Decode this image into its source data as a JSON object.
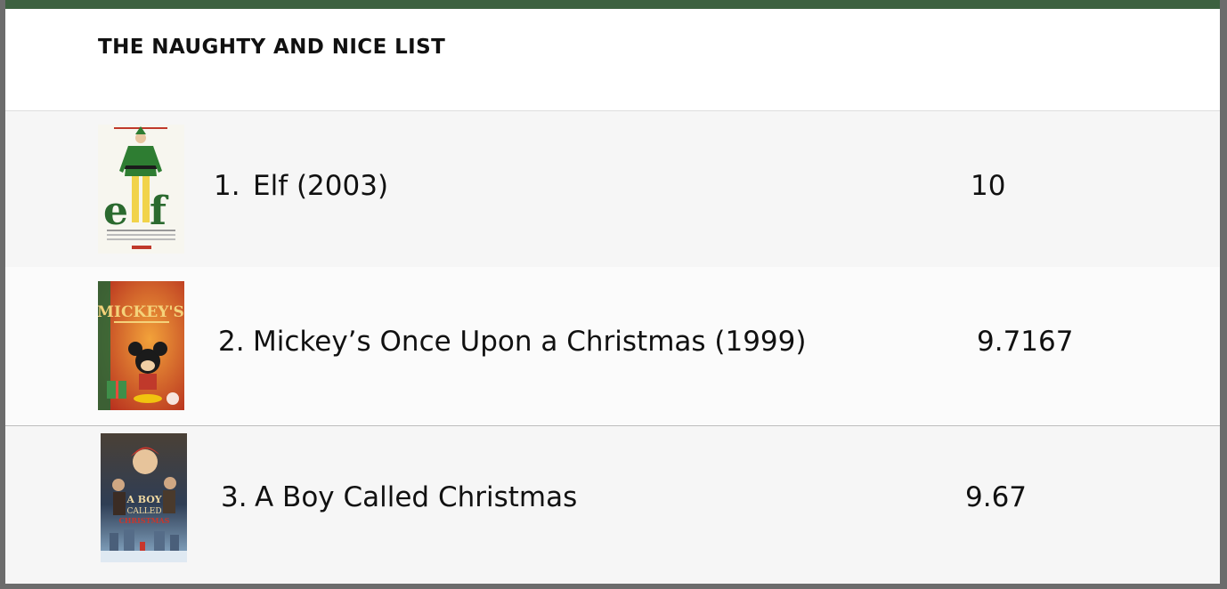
{
  "list": {
    "title": "THE NAUGHTY AND NICE LIST",
    "entries": [
      {
        "rank": "1.",
        "title": "Elf (2003)",
        "score": "10",
        "poster": {
          "icon": "elf-poster-image",
          "background": "#f7f6ef",
          "accent": "#2e7d32",
          "text_color": "#2b6a2f"
        }
      },
      {
        "rank": "2.",
        "title": "Mickey’s Once Upon a Christmas (1999)",
        "score": "9.7167",
        "poster": {
          "icon": "mickey-christmas-poster-image",
          "background": "#d9552b",
          "accent": "#1d6b3a",
          "text_color": "#f4d27a"
        }
      },
      {
        "rank": "3.",
        "title": "A Boy Called Christmas",
        "score": "9.67",
        "poster": {
          "icon": "boy-called-christmas-poster-image",
          "background": "#2f3e55",
          "accent": "#c8372d",
          "text_color": "#f1d9a0"
        }
      }
    ]
  },
  "colors": {
    "top_bar": "#3d6140",
    "row_alt": "#f6f6f6",
    "frame": "#6c6c6c"
  }
}
